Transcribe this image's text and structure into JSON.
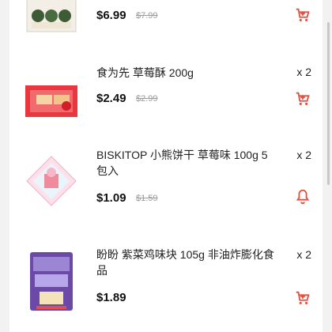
{
  "items": [
    {
      "title": "",
      "qty": "",
      "price": "$6.99",
      "old_price": "$7.99",
      "action": "add-to-cart"
    },
    {
      "title": "食为先 草莓酥 200g",
      "qty": "x 2",
      "price": "$2.49",
      "old_price": "$2.99",
      "action": "add-to-cart"
    },
    {
      "title": "BISKITOP 小熊饼干 草莓味 100g 5包入",
      "qty": "x 2",
      "price": "$1.09",
      "old_price": "$1.59",
      "action": "notify"
    },
    {
      "title": "盼盼 紫菜鸡味块 105g 非油炸膨化食品",
      "qty": "x 2",
      "price": "$1.89",
      "old_price": "",
      "action": "add-to-cart"
    }
  ],
  "colors": {
    "accent": "#e74c3c",
    "price": "#111111",
    "strike": "#9a9a9a"
  },
  "icons": {
    "cart": "cart-plus-icon",
    "bell": "bell-icon"
  }
}
